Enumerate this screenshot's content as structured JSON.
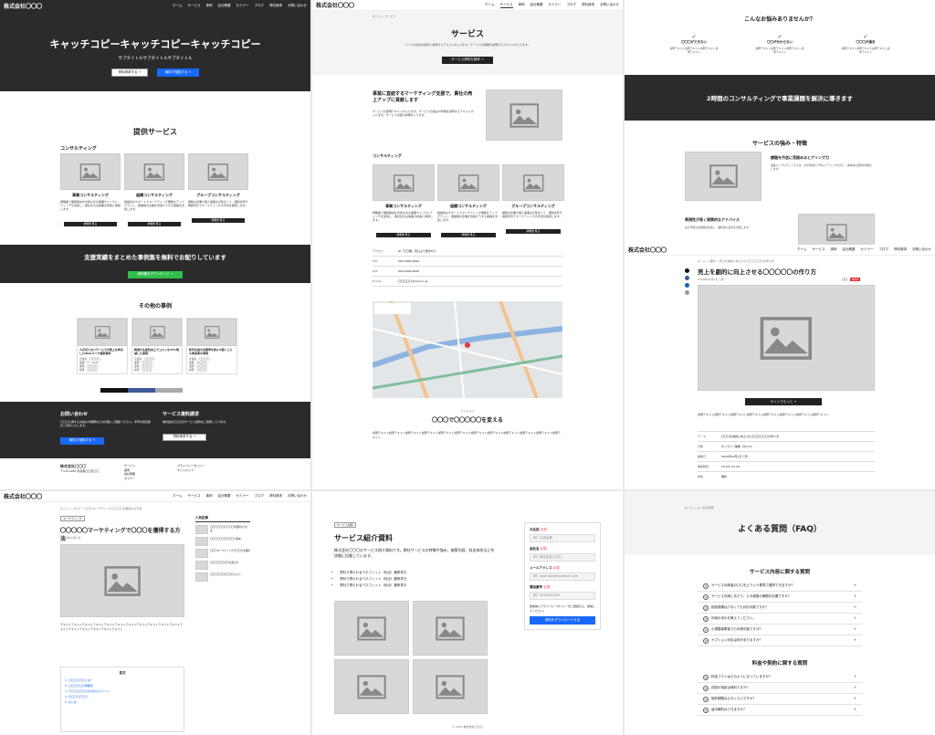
{
  "colors": {
    "dark": "#2b2b2b",
    "accent_blue": "#1769ff",
    "accent_green": "#2fbf4a",
    "placeholder": "#d8d8d8"
  },
  "company": "株式会社〇〇〇",
  "nav": [
    "ホーム",
    "サービス",
    "事例",
    "会社概要",
    "セミナー",
    "ブログ",
    "資料請求",
    "お問い合わせ"
  ],
  "top": {
    "hero_title": "キャッチコピーキャッチコピーキャッチコピー",
    "hero_sub": "サブタイトルサブタイトルサブタイトル",
    "hero_btn1": "資料請求する →",
    "hero_btn2": "無料で相談する →",
    "services_title": "提供サービス",
    "consulting_label": "コンサルティング",
    "cards": [
      {
        "title": "事業コンサルティング",
        "text": "戦略面で課題解決を支援なまの事業サミンサルティングを実施し、貴社社のは事業の成長に貢献します。",
        "btn": "詳細を見る"
      },
      {
        "title": "組織コンサルティング",
        "text": "組織的なサポートでマーケティング機能をアップグランし、貴組織の企業を目指そうする組織を支援します。",
        "btn": "詳細を見る"
      },
      {
        "title": "グループコンサルティング",
        "text": "複数の企業や個人事業主が集まって、課題共有や相談形式でマーケティングの手法を確認します。",
        "btn": "詳細を見る"
      }
    ],
    "cta_title": "支援実績をまとめた事例集を無料でお配りしています",
    "cta_btn": "事例集をダウンロード →",
    "other_cases": "その他の事例",
    "cases": [
      {
        "title": "人が足りないチームでの売上を伸ばしたWebマーケ施策事例",
        "rows": [
          [
            "企業名",
            "〇〇〇〇"
          ],
          [
            "業種",
            "IT・SaaS"
          ],
          [
            "課題",
            "〇〇〇〇"
          ],
          [
            "成果",
            "〇〇〇〇"
          ]
        ]
      },
      {
        "title": "物流の生産性向上でコストを25%削減した事例",
        "rows": [
          [
            "企業名",
            "〇〇〇〇"
          ],
          [
            "業種",
            "〇〇〇〇"
          ],
          [
            "課題",
            "〇〇〇〇"
          ],
          [
            "成果",
            "〇〇〇〇"
          ]
        ]
      },
      {
        "title": "新卒社員の定着率を約2.5倍にした人事改革の事例",
        "rows": [
          [
            "企業名",
            "〇〇〇〇"
          ],
          [
            "業種",
            "〇〇〇〇"
          ],
          [
            "課題",
            "〇〇〇〇"
          ],
          [
            "成果",
            "〇〇〇〇"
          ]
        ]
      }
    ],
    "contact_title": "お問い合わせ",
    "contact_text": "〇〇〇に関するお悩みや疑問などお気軽にご相談ください。専門の担当者がご対応いたします。",
    "contact_btn": "無料で相談する →",
    "docs_title": "サービス資料請求",
    "docs_text": "株式会社〇〇〇のサービス資料をご用意しています。",
    "docs_btn": "資料請求する →",
    "footer_company": "株式会社〇〇〇",
    "footer_addr": "〒100-0000 東京都〇〇区〇〇",
    "footer_links": [
      "サービス",
      "事例",
      "会社概要",
      "セミナー",
      "ブログ"
    ],
    "footer_links2": [
      "プライバシーポリシー",
      "サイトマップ"
    ]
  },
  "service": {
    "breadcrumb": "ホーム > サービス",
    "title": "サービス",
    "lead": "ページの目的を簡潔に説明するテキストが入ります。サービスの概要を説明するテキストが入ります。",
    "btn": "サービス資料を請求 →",
    "feature_title": "事業に直結するマーケティング支援で、貴社の売上アップに貢献します",
    "feature_text": "サービスの説明テキストが入ります。サービスの強みや特徴を説明するテキストが入ります。サービス内容の詳細が入ります。",
    "consulting_label": "コンサルティング",
    "table": [
      [
        "アクセス",
        "JR「〇〇駅」東口より徒歩5分"
      ],
      [
        "TEL",
        "000-0000-0000"
      ],
      [
        "FAX",
        "000-0000-0000"
      ],
      [
        "E-mail",
        "〇〇〇〇〇@mail.co.jp"
      ]
    ],
    "mission_label": "ミッション",
    "mission_title": "〇〇〇で〇〇〇〇〇を変える",
    "mission_text": "説明テキスト説明テキスト説明テキスト説明テキスト説明テキスト説明テキスト説明テキスト説明テキスト説明テキスト説明テキスト説明テキスト説明テキスト",
    "map_label": "地図"
  },
  "features": {
    "question": "こんなお悩みありませんか？",
    "worries": [
      {
        "title": "〇〇〇ができない",
        "text": "説明テキスト説明テキスト説明テキスト説明テキスト"
      },
      {
        "title": "〇〇が分からない",
        "text": "説明テキスト説明テキスト説明テキスト説明テキスト"
      },
      {
        "title": "〇〇〇が過多",
        "text": "説明テキスト説明テキスト説明テキスト説明テキスト"
      }
    ],
    "banner": "2時間のコンサルティングで事業課題を解決に導きます",
    "strengths_title": "サービスの強み・特徴",
    "s1_title": "課題を丹念に見極めるヒアリング力",
    "s1_text": "事業コンサルティングでは、まず現状の丁寧なヒアリングを行い、本質的な課題を明確にします。",
    "s2_title": "実現性が高く現実的なアドバイス",
    "s2_text": "実行可能な具体策を提案し、継続的に改善を支援します。"
  },
  "article": {
    "breadcrumb": "ホーム > 事例 > 売上を劇的に向上させる〇〇〇〇〇の作り方",
    "title": "売上を劇的に向上させる〇〇〇〇〇の作り方",
    "date": "2024年10月1日（月）",
    "author": "〇〇",
    "badge": "NEW",
    "btn": "サイトでもっと →",
    "body": "説明テキスト説明テキスト説明テキスト説明テキスト説明テキスト説明テキスト説明テキスト説明テキスト",
    "rows": [
      [
        "テーマ",
        "〇〇〇を劇的に向上させる〇〇〇〇〇の作り方"
      ],
      [
        "日時",
        "オンライン開催（Zoom）"
      ],
      [
        "開催日",
        "2024年10月1日（月）"
      ],
      [
        "開催時間",
        "10:00〜11:00"
      ],
      [
        "参加",
        "無料"
      ]
    ]
  },
  "blog": {
    "breadcrumb": "ホーム > ブログ > 〇〇〇マーケティングで〇〇〇を獲得する方法",
    "category": "マーケティング",
    "title": "〇〇〇〇〇マーケティングで〇〇〇を獲得する方法",
    "date": "2024年10月1日",
    "body": "テキストテキストテキストテキストテキストテキストテキストテキストテキストテキストテキストテキストテキストテキストテキストテキストテキスト",
    "popular": "人気記事",
    "popular_items": [
      "〇〇〇〇〇〇〇〇〇〇を獲得する方法",
      "〇〇〇〇〇〇〇〇〇〇の基本",
      "〇〇〇マーケティングで〇〇〇を獲得",
      "〇〇〇〇〇〇〇〇の選び方",
      "〇〇〇〇〇〇〇〇〇〇のコツ"
    ],
    "toc_title": "目次",
    "toc": [
      "1. 〇〇〇〇〇〇とは？",
      "2. 〇〇〇〇〇の重要性",
      "3. 〇〇〇〇〇〇〇を高めるポイント",
      "4. 〇〇〇〇〇〇〇",
      "5. まとめ"
    ]
  },
  "download": {
    "label": "サービス資料",
    "title": "サービス紹介資料",
    "text": "株式会社〇〇〇のサービス紹介資料です。弊社サービスの特徴や強み、施策内容、料金体系などを詳細に記載しています。",
    "bullets": [
      "資料で得られるベネフィット（利点）箇条書き",
      "資料で得られるベネフィット（利点）箇条書き",
      "資料で得られるベネフィット（利点）箇条書き"
    ],
    "form": {
      "name_label": "お名前",
      "name_ph": "例）山田太郎",
      "company_label": "会社名",
      "company_ph": "例）株式会社〇〇〇",
      "email_label": "メールアドレス",
      "email_ph": "例）example@example.com",
      "tel_label": "電話番号",
      "tel_ph": "例）0000000000",
      "required": "必須",
      "privacy": "送信前にプライバシーポリシーをご確認の上、送信してください。",
      "submit": "資料をダウンロードする"
    },
    "copyright": "© 2024 株式会社〇〇〇"
  },
  "faq": {
    "breadcrumb": "ホーム > よくある質問",
    "title": "よくある質問（FAQ）",
    "sec1": "サービス内容に関する質問",
    "q1": [
      "サービス利用者の〇〇をどういう基準で選択できますか？",
      "サービス利用にあたり、どの程度の期間が必要ですか？",
      "相談規模は少なくても対応可能ですか？",
      "利用の流れを教えてください。",
      "小規模事業者でも利用可能ですか？",
      "オプション対応は何がありますか？"
    ],
    "sec2": "料金や契約に関する質問",
    "q2": [
      "料金プランはどのようになっていますか？",
      "初回の相談は無料ですか？",
      "契約期間はどれくらいですか？",
      "途中解約はできますか？"
    ]
  }
}
